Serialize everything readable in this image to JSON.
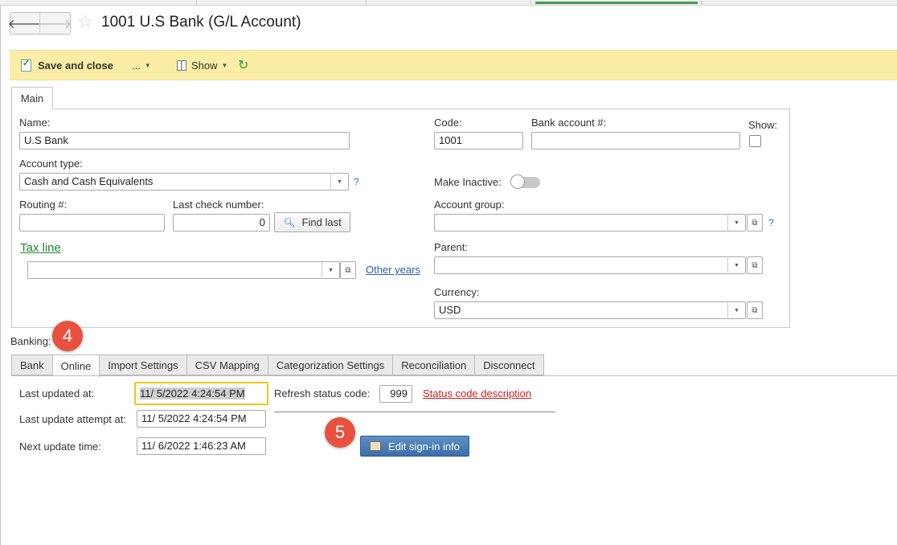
{
  "window": {
    "title": "1001 U.S Bank (G/L Account)"
  },
  "toolbar": {
    "save_label": "Save and close",
    "more_label": "...",
    "show_label": "Show"
  },
  "main_tab": "Main",
  "form": {
    "name_label": "Name:",
    "name_value": "U.S Bank",
    "account_type_label": "Account type:",
    "account_type_value": "Cash and Cash Equivalents",
    "routing_label": "Routing #:",
    "routing_value": "",
    "last_check_label": "Last check number:",
    "last_check_value": "0",
    "find_last_label": "Find last",
    "tax_line_label": "Tax line",
    "tax_line_value": "",
    "other_years_label": "Other years",
    "code_label": "Code:",
    "code_value": "1001",
    "bank_account_label": "Bank account #:",
    "bank_account_value": "",
    "show_label": "Show:",
    "make_inactive_label": "Make Inactive:",
    "account_group_label": "Account group:",
    "account_group_value": "",
    "parent_label": "Parent:",
    "parent_value": "",
    "currency_label": "Currency:",
    "currency_value": "USD",
    "help_mark": "?"
  },
  "banking": {
    "label": "Banking:",
    "tabs": [
      "Bank",
      "Online",
      "Import Settings",
      "CSV Mapping",
      "Categorization Settings",
      "Reconciliation",
      "Disconnect"
    ],
    "active_tab": "Online",
    "last_updated_label": "Last updated at:",
    "last_updated_value": "11/ 5/2022  4:24:54 PM",
    "last_attempt_label": "Last update attempt at:",
    "last_attempt_value": "11/ 5/2022  4:24:54 PM",
    "next_update_label": "Next update time:",
    "next_update_value": "11/ 6/2022  1:46:23 AM",
    "refresh_status_label": "Refresh status code:",
    "refresh_status_value": "999",
    "status_desc_label": "Status code description",
    "edit_signin_label": "Edit sign-in info"
  },
  "annotations": {
    "badge_4": "4",
    "badge_5": "5"
  },
  "colors": {
    "toolbar_bg": "#fbeda6",
    "link_green": "#1f8a2a",
    "link_red": "#d01c1c",
    "badge": "#e85040",
    "primary_button": "#3b6ea8"
  }
}
